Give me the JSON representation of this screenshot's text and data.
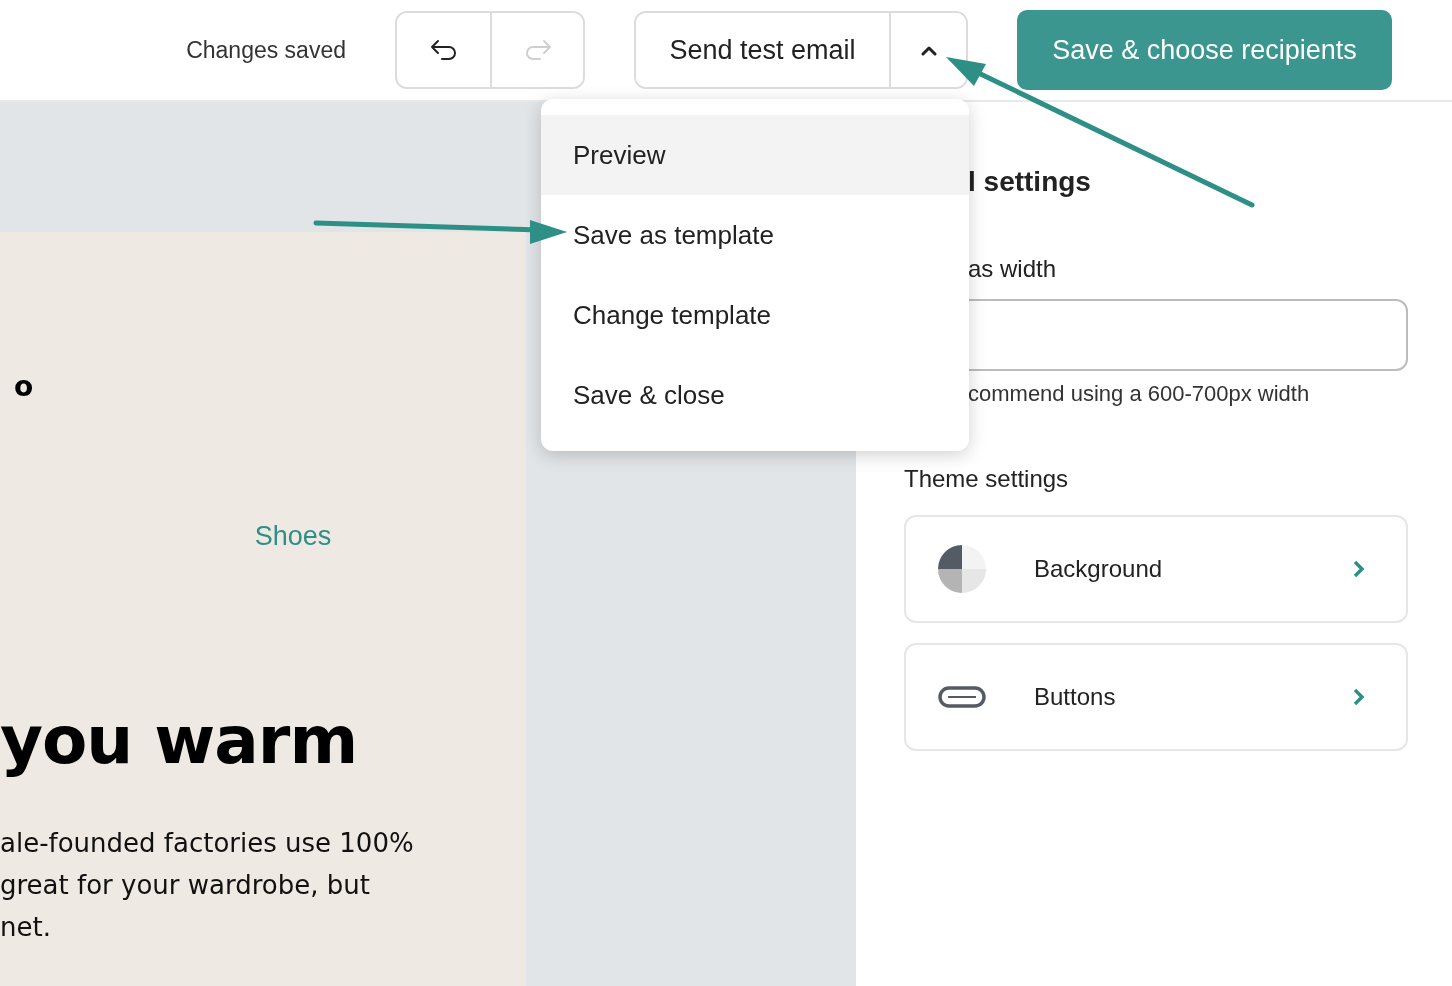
{
  "toolbar": {
    "status": "Changes saved",
    "undo": {
      "disabled": false
    },
    "redo": {
      "disabled": true
    },
    "send_test": {
      "label": "Send test email",
      "expanded": true
    },
    "primary": "Save & choose recipients"
  },
  "menu": [
    {
      "label": "Preview",
      "selected": true
    },
    {
      "label": "Save as template",
      "selected": false
    },
    {
      "label": "Change template",
      "selected": false
    },
    {
      "label": "Save & close",
      "selected": false
    }
  ],
  "email": {
    "logo": "o",
    "link": "Shoes",
    "heading": "you warm",
    "body_lines": [
      "ale-founded factories use 100%",
      "great for your wardrobe, but",
      "net."
    ]
  },
  "settings": {
    "title": "l settings",
    "width_label": "as width",
    "width_hint": "commend using a 600-700px width",
    "theme_title": "Theme settings",
    "theme_items": [
      {
        "label": "Background",
        "kind": "background"
      },
      {
        "label": "Buttons",
        "kind": "buttons"
      }
    ]
  }
}
